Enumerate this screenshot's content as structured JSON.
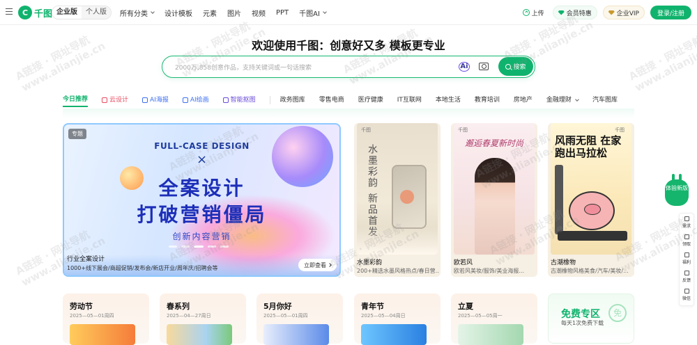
{
  "topbar": {
    "logo_text": "千图",
    "edition": [
      "企业版",
      "个人版"
    ],
    "nav": [
      {
        "label": "所有分类",
        "dropdown": true
      },
      {
        "label": "设计模板",
        "dropdown": false
      },
      {
        "label": "元素",
        "dropdown": false
      },
      {
        "label": "图片",
        "dropdown": false
      },
      {
        "label": "视频",
        "dropdown": false
      },
      {
        "label": "PPT",
        "dropdown": false
      },
      {
        "label": "千图AI",
        "dropdown": true
      }
    ],
    "upload": "上传",
    "vip": "会员特惠",
    "enterprise_vip": "企业VIP",
    "login": "登录/注册"
  },
  "hero": {
    "title": "欢迎使用千图：创意好又多 模板更专业",
    "search_placeholder": "2000万,858创意作品，支持关键词或一句话搜索",
    "search_button": "搜索"
  },
  "categories": [
    {
      "label": "今日推荐",
      "style": "active"
    },
    {
      "label": "云设计",
      "style": "red"
    },
    {
      "label": "AI海报",
      "style": "blue"
    },
    {
      "label": "AI绘画",
      "style": "blue"
    },
    {
      "label": "智能抠图",
      "style": "purple"
    },
    {
      "label": "政务图库",
      "style": "plain"
    },
    {
      "label": "零售电商",
      "style": "plain"
    },
    {
      "label": "医疗健康",
      "style": "plain"
    },
    {
      "label": "IT互联网",
      "style": "plain"
    },
    {
      "label": "本地生活",
      "style": "plain"
    },
    {
      "label": "教育培训",
      "style": "plain"
    },
    {
      "label": "房地产",
      "style": "plain"
    },
    {
      "label": "金融理财",
      "style": "plain"
    },
    {
      "label": "汽车图库",
      "style": "plain"
    }
  ],
  "banner": {
    "tag": "专题",
    "en_title": "FULL-CASE DESIGN",
    "cross": "×",
    "title_line1": "全案设计",
    "title_line2": "打破营销僵局",
    "subtitle": "创新内容营销",
    "name": "行业全案设计",
    "desc": "1000+线下展会/商超促销/发布会/新店开业/周年庆/招聘会等",
    "button": "立即查看"
  },
  "posters": [
    {
      "name": "水墨彩韵",
      "desc": "200+精选水墨风格热点/春日营...",
      "art": "水墨彩韵 新品首发",
      "logo": "千图"
    },
    {
      "name": "欧若风",
      "desc": "欧若风美妆/服饰/美业海报...",
      "art": "邂逅春夏新时尚",
      "logo": "千图"
    },
    {
      "name": "古潮橡物",
      "desc": "古潮橡物风格美食/汽车/美妆/...",
      "art": "风雨无阻 在家跑出马拉松",
      "logo": "千图"
    }
  ],
  "topics": [
    {
      "title": "劳动节",
      "date": "2025—05—01周四"
    },
    {
      "title": "春系列",
      "date": "2025—04—27周日"
    },
    {
      "title": "5月你好",
      "date": "2025—05—01周四"
    },
    {
      "title": "青年节",
      "date": "2025—05—04周日"
    },
    {
      "title": "立夏",
      "date": "2025—05—05周一"
    }
  ],
  "free_zone": {
    "title": "免费专区",
    "desc": "每天1次免费下载",
    "badge": "免"
  },
  "side": {
    "trial": "体验新版",
    "items": [
      "需求",
      "领取",
      "福利",
      "反馈",
      "微信"
    ]
  },
  "watermark": {
    "line1": "A链接 · 网址导航",
    "line2": "www.alianjie.cn"
  },
  "colors": {
    "brand": "#10b36d",
    "accent_red": "#e84a5f",
    "accent_blue": "#3d6ff0",
    "accent_purple": "#6a4bd8"
  }
}
